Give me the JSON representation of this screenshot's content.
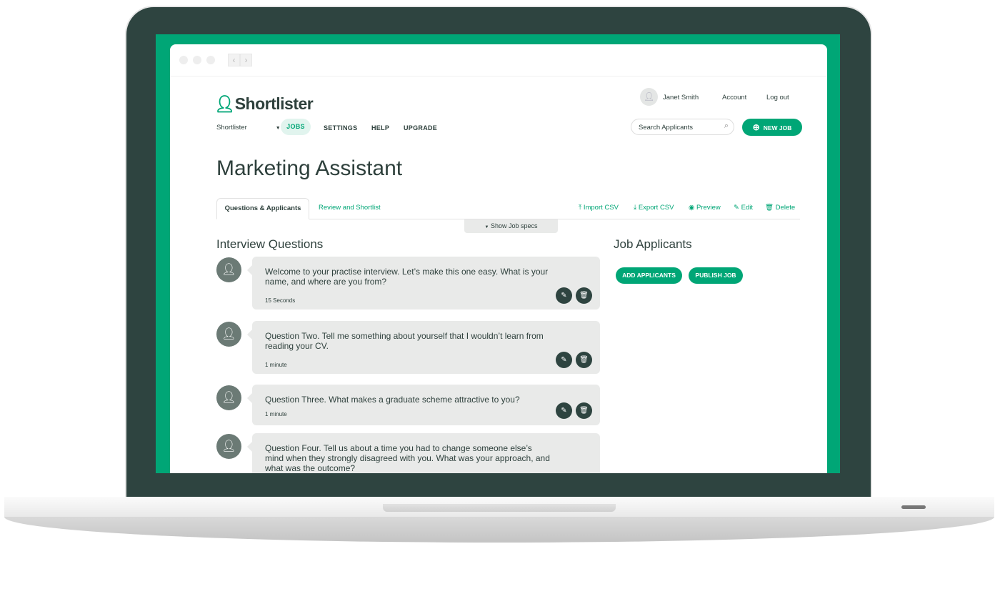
{
  "app": {
    "logo": "Shortlister",
    "user": "Janet Smith",
    "account": "Account",
    "logout": "Log out"
  },
  "nav": {
    "org": "Shortlister",
    "items": [
      "JOBS",
      "SETTINGS",
      "HELP",
      "UPGRADE"
    ],
    "active": "JOBS"
  },
  "search": {
    "placeholder": "Search Applicants"
  },
  "new_job": "NEW JOB",
  "page_title": "Marketing Assistant",
  "tabs": [
    "Questions & Applicants",
    "Review and Shortlist"
  ],
  "actions": [
    "Import CSV",
    "Export CSV",
    "Preview",
    "Edit",
    "Delete"
  ],
  "show_specs": "Show Job specs",
  "questions_heading": "Interview Questions",
  "questions": [
    {
      "text": "Welcome to your practise interview. Let’s make this one easy. What is your name, and where are you from?",
      "duration": "15 Seconds"
    },
    {
      "text": "Question Two. Tell me something about yourself that I wouldn’t learn from reading your CV.",
      "duration": "1 minute"
    },
    {
      "text": "Question Three. What makes a graduate scheme attractive to you?",
      "duration": "1 minute"
    },
    {
      "text": "Question Four. Tell us about a time you had to change someone else’s mind when they strongly disagreed with you. What was your approach, and what was the outcome?",
      "duration": ""
    }
  ],
  "applicants_heading": "Job Applicants",
  "add_applicants": "ADD APPLICANTS",
  "publish_job": "PUBLISH JOB",
  "colors": {
    "brand": "#00a676",
    "dark": "#2e4440"
  }
}
